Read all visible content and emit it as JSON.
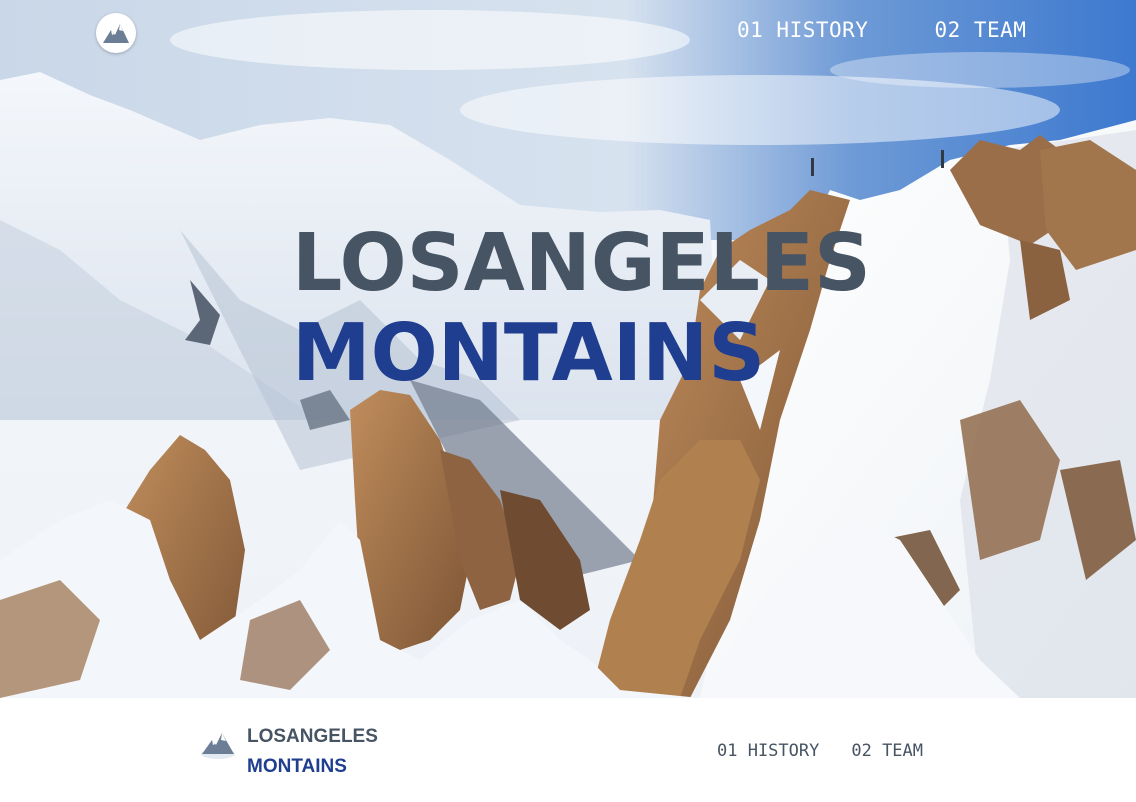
{
  "header": {
    "logo_icon": "mountain-icon",
    "nav": [
      {
        "label": "01 HISTORY"
      },
      {
        "label": "02 TEAM"
      }
    ]
  },
  "hero": {
    "title_line1": "LOSANGELES",
    "title_line2": "MONTAINS",
    "image_description_icon": "mountain-landscape"
  },
  "footer": {
    "brand_line1": "LOSANGELES",
    "brand_line2": "MONTAINS",
    "logo_icon": "mountain-icon",
    "nav": [
      {
        "label": "01 HISTORY"
      },
      {
        "label": "02 TEAM"
      }
    ]
  },
  "colors": {
    "title_gray": "#475463",
    "title_blue": "#1f3e8f",
    "nav_text": "#ffffff",
    "footer_text": "#475463"
  }
}
